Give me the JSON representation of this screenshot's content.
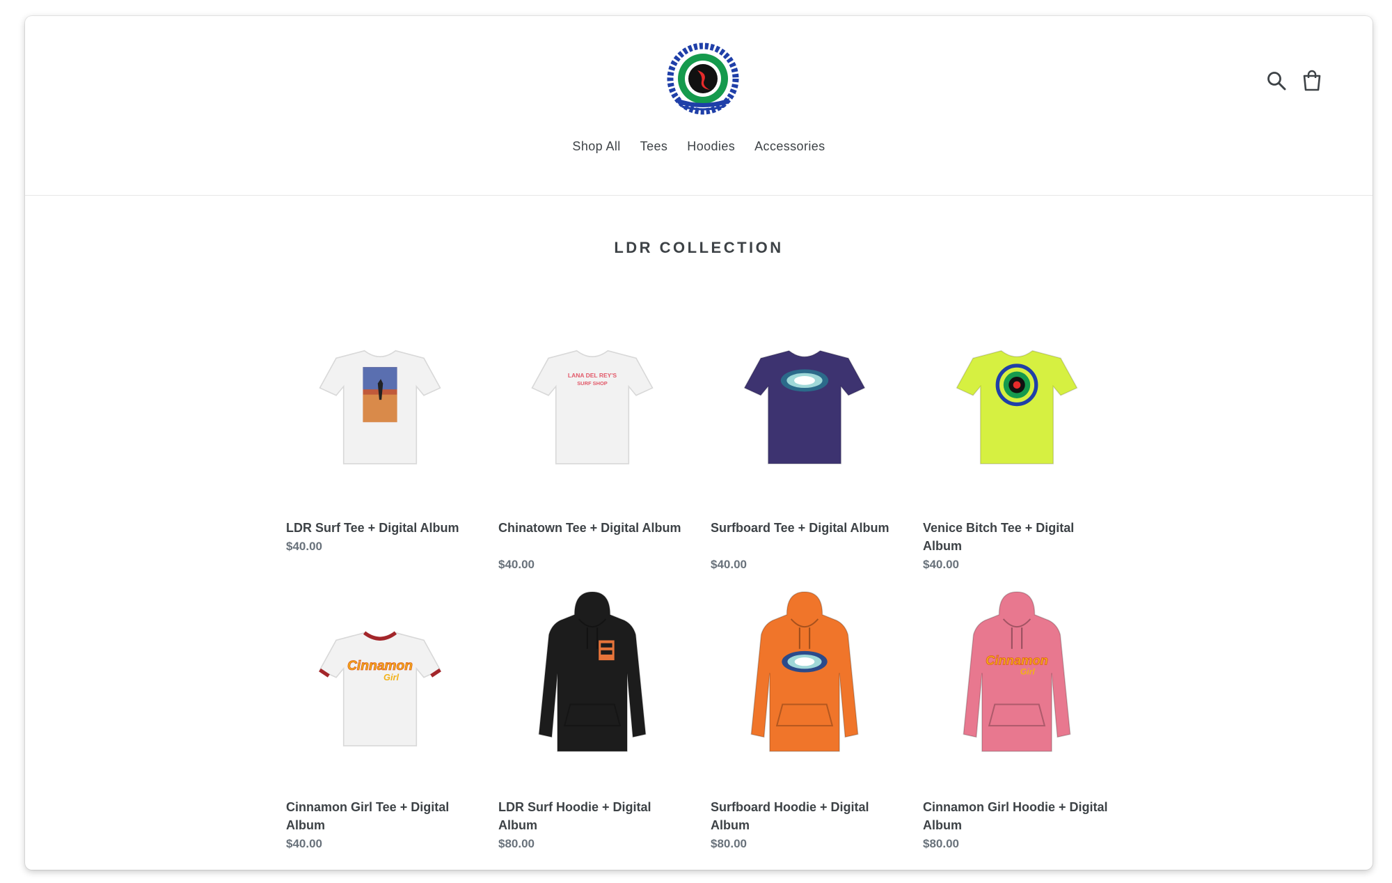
{
  "store": {
    "logo_text": "LANA FUCKING DEL REY'S LDR Surf Shop Venice Bitch California Since 1985"
  },
  "nav": [
    "Shop All",
    "Tees",
    "Hoodies",
    "Accessories"
  ],
  "collection_title": "LDR COLLECTION",
  "products": [
    {
      "name": "LDR Surf Tee + Digital Album",
      "price": "$40.00",
      "garment": "tee",
      "color": "#f2f2f2",
      "print": "surf-photo"
    },
    {
      "name": "Chinatown Tee + Digital Album",
      "price": "$40.00",
      "garment": "tee",
      "color": "#f2f2f2",
      "print": "surf-shop-text"
    },
    {
      "name": "Surfboard Tee + Digital Album",
      "price": "$40.00",
      "garment": "tee",
      "color": "#3d3370",
      "print": "surfboard-oval"
    },
    {
      "name": "Venice Bitch Tee + Digital Album",
      "price": "$40.00",
      "garment": "tee",
      "color": "#d6f041",
      "print": "circle-logo"
    },
    {
      "name": "Cinnamon Girl Tee + Digital Album",
      "price": "$40.00",
      "garment": "ringer-tee",
      "color": "#f2f2f2",
      "print": "cinnamon-girl-text"
    },
    {
      "name": "LDR Surf Hoodie + Digital Album",
      "price": "$80.00",
      "garment": "hoodie",
      "color": "#1c1c1c",
      "print": "pocket-print"
    },
    {
      "name": "Surfboard Hoodie + Digital Album",
      "price": "$80.00",
      "garment": "hoodie",
      "color": "#f0752a",
      "print": "surfboard-oval"
    },
    {
      "name": "Cinnamon Girl Hoodie + Digital Album",
      "price": "$80.00",
      "garment": "hoodie",
      "color": "#e8788f",
      "print": "cinnamon-girl-text"
    }
  ],
  "icons": {
    "search": "search-icon",
    "cart": "shopping-bag-icon"
  }
}
